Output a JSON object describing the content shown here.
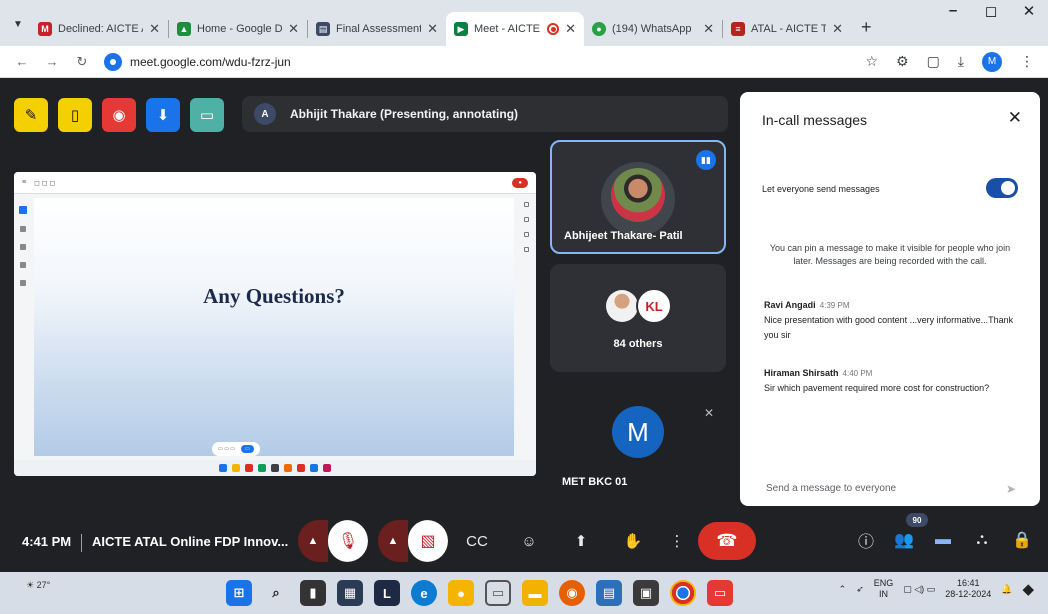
{
  "browser": {
    "tabs": [
      {
        "title": "Declined: AICTE A",
        "icon": "gmail-icon",
        "color": "#c5222c",
        "glyph": "M"
      },
      {
        "title": "Home - Google D",
        "icon": "drive-icon",
        "color": "#1e8e3e",
        "glyph": "▲"
      },
      {
        "title": "Final Assessment",
        "icon": "forms-icon",
        "color": "#3c4a66",
        "glyph": "▤"
      },
      {
        "title": "Meet - AICTE",
        "icon": "meet-icon",
        "color": "#0b8043",
        "glyph": "▶"
      },
      {
        "title": "(194) WhatsApp",
        "icon": "whatsapp-icon",
        "color": "#25a244",
        "glyph": "●"
      },
      {
        "title": "ATAL - AICTE Trai",
        "icon": "atal-icon",
        "color": "#b3261e",
        "glyph": "≡"
      }
    ],
    "url": "meet.google.com/wdu-fzrz-jun",
    "profile_initial": "M"
  },
  "meet": {
    "presenting_initial": "A",
    "presenting_label": "Abhijit Thakare (Presenting, annotating)",
    "slide_title": "Any Questions?",
    "participants": {
      "speaker_name": "Abhijeet Thakare- Patil",
      "others_label": "84 others",
      "others_logo": "KL",
      "third_initial": "M",
      "third_name": "MET BKC 01"
    },
    "chat": {
      "title": "In-call messages",
      "toggle_label": "Let everyone send messages",
      "toggle_on": true,
      "info": "You can pin a message to make it visible for people who join later. Messages are being recorded with the call.",
      "messages": [
        {
          "sender": "Ravi Angadi",
          "time": "4:39 PM",
          "text": "Nice presentation with good content ...very informative...Thank you sir"
        },
        {
          "sender": "Hiraman Shirsath",
          "time": "4:40 PM",
          "text": "Sir which pavement required more cost for construction?"
        }
      ],
      "compose_placeholder": "Send a message to everyone"
    },
    "controls": {
      "time": "4:41 PM",
      "meeting_title": "AICTE ATAL Online FDP Innov...",
      "participant_count": "90"
    }
  },
  "taskbar": {
    "temperature": "27°",
    "lang_top": "ENG",
    "lang_bottom": "IN",
    "time": "16:41",
    "date": "28-12-2024"
  }
}
